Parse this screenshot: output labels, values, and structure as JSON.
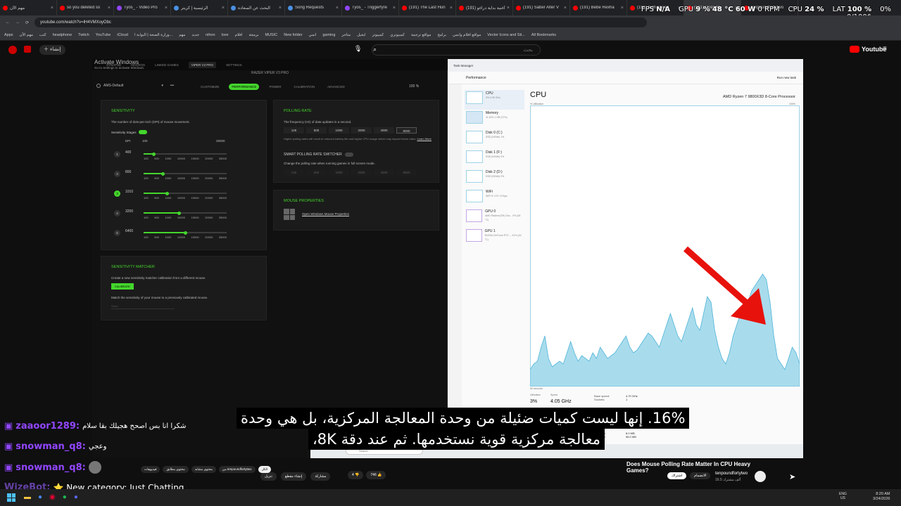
{
  "tabs": [
    {
      "label": "مهم الآن",
      "icon": "youtube-icon"
    },
    {
      "label": "so you deleted so",
      "icon": "youtube-icon"
    },
    {
      "label": "Tyos_ - Video Pro",
      "icon": "twitch-icon"
    },
    {
      "label": "الرئيسية | كريتر",
      "icon": "web-icon"
    },
    {
      "label": "البحث عن السعادة",
      "icon": "web-icon"
    },
    {
      "label": "Song Requests",
      "icon": "web-icon"
    },
    {
      "label": "Tyos_ - Triggerfyre",
      "icon": "twitch-icon"
    },
    {
      "label": "(191) The Last Hun",
      "icon": "youtube-icon"
    },
    {
      "label": "(191) أغنية بداية دراغو",
      "icon": "youtube-icon"
    },
    {
      "label": "(191) Saber Alter V",
      "icon": "youtube-icon"
    },
    {
      "label": "(191) Bebe Rexha",
      "icon": "youtube-icon"
    },
    {
      "label": "(191) high speed",
      "icon": "youtube-icon"
    },
    {
      "label": "(191) Does M",
      "icon": "youtube-icon"
    },
    {
      "label": "tenpoundfortytwo",
      "icon": "youtube-icon"
    }
  ],
  "hud": {
    "fps_label": "FPS",
    "fps": "N/A",
    "gpu_label": "GPU",
    "gpu": "9 %",
    "gpu_temp": "48 °C",
    "gpu_power": "60 W",
    "gpu_rpm": "0 RPM",
    "cpu_label": "CPU",
    "cpu": "24 %",
    "lat_label": "LAT",
    "lat": "100 %",
    "extra1": "0/100$",
    "extra2": "0%"
  },
  "address": {
    "url": "youtube.com/watch?v=lH4VMXoyObc"
  },
  "bookmarks": [
    "Apps",
    "مهم الآن",
    "كتب",
    "headphone",
    "Twitch",
    "YouTube",
    "iCloud",
    "وزارة الصحة | البوابة ا...",
    "مهم",
    "جديد",
    "nihon",
    "love",
    "افلام",
    "برمجة",
    "MUSIC",
    "New folder",
    "انمي",
    "gaming",
    "متاجر",
    "ابجيل",
    "كمبيوتر",
    "كمبيوتري",
    "مواقع ترجمة",
    "برامج",
    "مواقع افلام وانمي",
    "Vector Icons and Sti...",
    "All Bookmarks"
  ],
  "youtube": {
    "search_placeholder": "",
    "brand": "Youtube",
    "search_hint": "بحث",
    "home_label": "إنشاء"
  },
  "synapse": {
    "watermark": "Activate Windows",
    "watermark_sub": "Go to Settings to activate Windows.",
    "topnav": [
      "SYNAPSE",
      "MACROS",
      "LINKED GAMES",
      "VIPER V3 PRO",
      "SETTINGS"
    ],
    "device_title": "RAZER VIPER V3 PRO",
    "profile": "AMS-Default",
    "tabs": [
      "CUSTOMIZE",
      "PERFORMANCE",
      "POWER",
      "CALIBRATION",
      "ADVANCED"
    ],
    "active_tab": "PERFORMANCE",
    "battery": "100 %",
    "sensitivity": {
      "title": "SENSITIVITY",
      "desc": "The number of dots-per-inch (DPI) of mouse movement.",
      "stages_label": "Sensitivity Stages",
      "dpi_label": "DPI",
      "dpi_min": "100",
      "dpi_max": "35000",
      "stages": [
        {
          "num": "1",
          "value": "400",
          "fraction": 0.12
        },
        {
          "num": "2",
          "value": "800",
          "fraction": 0.23
        },
        {
          "num": "3",
          "value": "1010",
          "fraction": 0.28
        },
        {
          "num": "4",
          "value": "3200",
          "fraction": 0.42
        },
        {
          "num": "5",
          "value": "6400",
          "fraction": 0.5
        }
      ],
      "tick_labels": [
        "100",
        "500",
        "1000",
        "10000",
        "15000",
        "20000",
        "35000"
      ]
    },
    "polling": {
      "title": "POLLING RATE",
      "desc": "The frequency (Hz) of data updates in a second.",
      "rates": [
        "125",
        "500",
        "1000",
        "2000",
        "4000",
        "8000"
      ],
      "selected": "8000",
      "note": "Higher polling rates will result in reduced battery life and higher CPU usage which may impact frame rates.",
      "learn_more": "Learn More",
      "smart_title": "SMART POLLING RATE SWITCHER",
      "smart_desc": "Change the polling rate when running games in full screen mode.",
      "smart_rates": [
        "125",
        "500",
        "1000",
        "2000",
        "4000",
        "8000"
      ]
    },
    "mouse_props": {
      "title": "MOUSE PROPERTIES",
      "link": "Open Windows Mouse Properties"
    },
    "matcher": {
      "title": "SENSITIVITY MATCHER",
      "desc": "Create a new sensitivity matcher calibration from a different mouse.",
      "button": "CALIBRATE",
      "desc2": "Match the sensitivity of your mouse to a previously calibrated mouse.",
      "select": "None"
    }
  },
  "taskmgr": {
    "window_title": "Task Manager",
    "section": "Performance",
    "run_task": "Run new task",
    "heading": "CPU",
    "processor": "AMD Ryzen 7 9800X3D 8-Core Processor",
    "util_label": "% Utilization",
    "max_label": "100%",
    "seconds_label": "60 seconds",
    "items": [
      {
        "name": "CPU",
        "sub": "3% 4.05 GHz"
      },
      {
        "name": "Memory",
        "sub": "11.5/31.1 GB (37%)"
      },
      {
        "name": "Disk 0 (C:)",
        "sub": "SSD (NVMe) 1%"
      },
      {
        "name": "Disk 1 (F:)",
        "sub": "SSD (NVMe) 0%"
      },
      {
        "name": "Disk 2 (D:)",
        "sub": "SSD (NVMe) 0%"
      },
      {
        "name": "WiFi",
        "sub": "WiFi S: 0 R: 0 Kbps"
      },
      {
        "name": "GPU 0",
        "sub": "AMD Radeon(TM) Gra... 0% (48 °C)"
      },
      {
        "name": "GPU 1",
        "sub": "NVIDIA GeForce RTX ... 41% (44 °C)"
      }
    ],
    "stats": {
      "util_label": "Utilization",
      "util": "3%",
      "speed_label": "Speed",
      "speed": "4.05 GHz",
      "base_label": "Base speed:",
      "base": "4.70 GHz",
      "sockets_label": "Sockets:",
      "sockets": "1",
      "l2_label": "L2 cache:",
      "l2": "8.0 MB",
      "l3_label": "L3 cache:",
      "l3": "96.0 MB"
    },
    "cpu_samples": [
      6,
      8,
      9,
      14,
      18,
      10,
      7,
      8,
      9,
      8,
      12,
      16,
      12,
      9,
      11,
      10,
      9,
      12,
      10,
      14,
      12,
      10,
      11,
      12,
      14,
      16,
      18,
      14,
      12,
      13,
      15,
      17,
      19,
      18,
      16,
      14,
      18,
      22,
      26,
      22,
      18,
      16,
      20,
      24,
      28,
      22,
      20,
      26,
      32,
      30,
      20,
      14,
      10,
      8,
      12,
      18,
      22,
      26,
      28,
      30,
      34,
      36,
      38,
      40,
      38,
      30,
      18,
      10,
      8,
      6,
      10,
      14,
      12,
      8
    ]
  },
  "caption": {
    "line1": "16%. إنها ليست كميات ضئيلة من وحدة المعالجة المركزية، بل هي وحدة",
    "line2": "معالجة مركزية قوية نستخدمها.  ثم عند دقة 8K،"
  },
  "chat": [
    {
      "user": "zaaoor1289:",
      "text": "شكرا انا بس اصحح هجيلك بقا سلام"
    },
    {
      "user": "snowman_q8:",
      "text": "وعجي"
    },
    {
      "user": "snowman_q8:",
      "text": ""
    },
    {
      "user": "WizeBot:",
      "text": "⭐ New category: Just Chatting"
    }
  ],
  "video_info": {
    "title": "Does Mouse Polling Rate Matter In CPU Heavy Games?",
    "channel": "tenpoundfortytwo",
    "subs": "16.5 ألف مشترك",
    "subscribe": "اشتراك",
    "join": "الانضمام",
    "likes": "746",
    "dislikes": "4",
    "share": "مشاركة",
    "save": "حفظ",
    "download": "تنزيل",
    "clip": "إنشاء مقطع",
    "chips": [
      "الكل",
      "من tenpoundfortytwo",
      "محتوى مشابه",
      "محتوى مطابق",
      "فيديوهات"
    ]
  },
  "taskbar": {
    "time": "8:20 AM",
    "date": "3/24/2026",
    "lang": "ENG",
    "lang2": "US"
  }
}
